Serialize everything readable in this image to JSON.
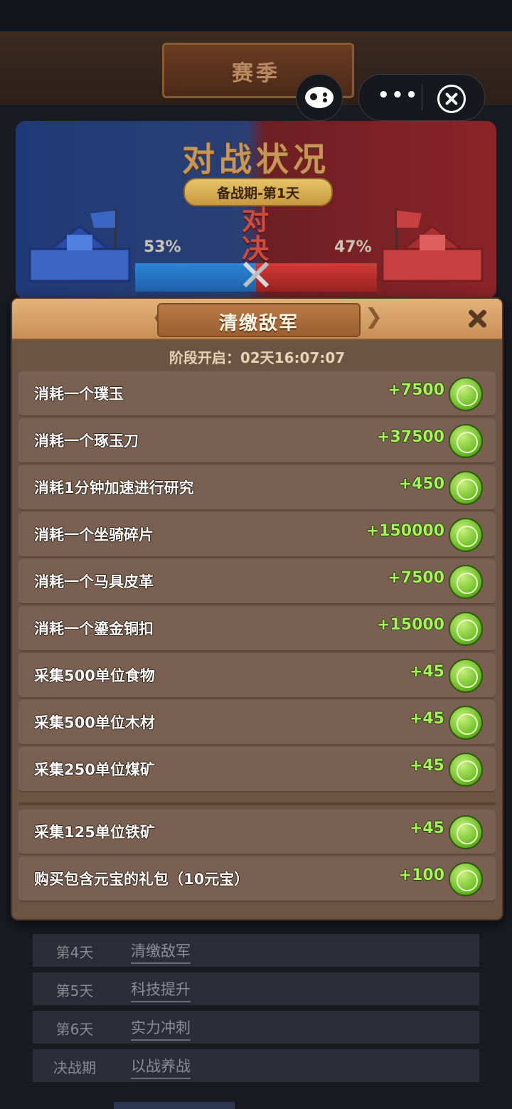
{
  "season": {
    "title": "赛季"
  },
  "battle": {
    "title": "对战状况",
    "phase": "备战期-第1天",
    "vs": "对\n决",
    "blue_percent": "53%",
    "red_percent": "47%",
    "blue_share": 0.53,
    "red_share": 0.47
  },
  "dialog": {
    "title": "清缴敌军",
    "timer": "阶段开启：02天16:07:07",
    "tasks": [
      {
        "label": "消耗一个璞玉",
        "points": "+7500"
      },
      {
        "label": "消耗一个琢玉刀",
        "points": "+37500"
      },
      {
        "label": "消耗1分钟加速进行研究",
        "points": "+450"
      },
      {
        "label": "消耗一个坐骑碎片",
        "points": "+150000"
      },
      {
        "label": "消耗一个马具皮革",
        "points": "+7500"
      },
      {
        "label": "消耗一个鎏金铜扣",
        "points": "+15000"
      },
      {
        "label": "采集500单位食物",
        "points": "+45"
      },
      {
        "label": "采集500单位木材",
        "points": "+45"
      },
      {
        "label": "采集250单位煤矿",
        "points": "+45"
      },
      {
        "label": "采集125单位铁矿",
        "points": "+45"
      },
      {
        "label": "购买包含元宝的礼包（10元宝）",
        "points": "+100"
      }
    ]
  },
  "schedule": [
    {
      "day": "第4天",
      "task": "清缴敌军"
    },
    {
      "day": "第5天",
      "task": "科技提升"
    },
    {
      "day": "第6天",
      "task": "实力冲刺"
    },
    {
      "day": "决战期",
      "task": "以战养战"
    }
  ],
  "icons": {
    "game_controller": "game-controller-icon",
    "more": "more-icon",
    "close": "close-icon",
    "points_coin": "dragon-coin-icon"
  },
  "colors": {
    "dialog_bg": "#6d5342",
    "header": "#d9a46b",
    "points": "#a6f25a",
    "blue_team": "#2b86d6",
    "red_team": "#d43a36"
  }
}
